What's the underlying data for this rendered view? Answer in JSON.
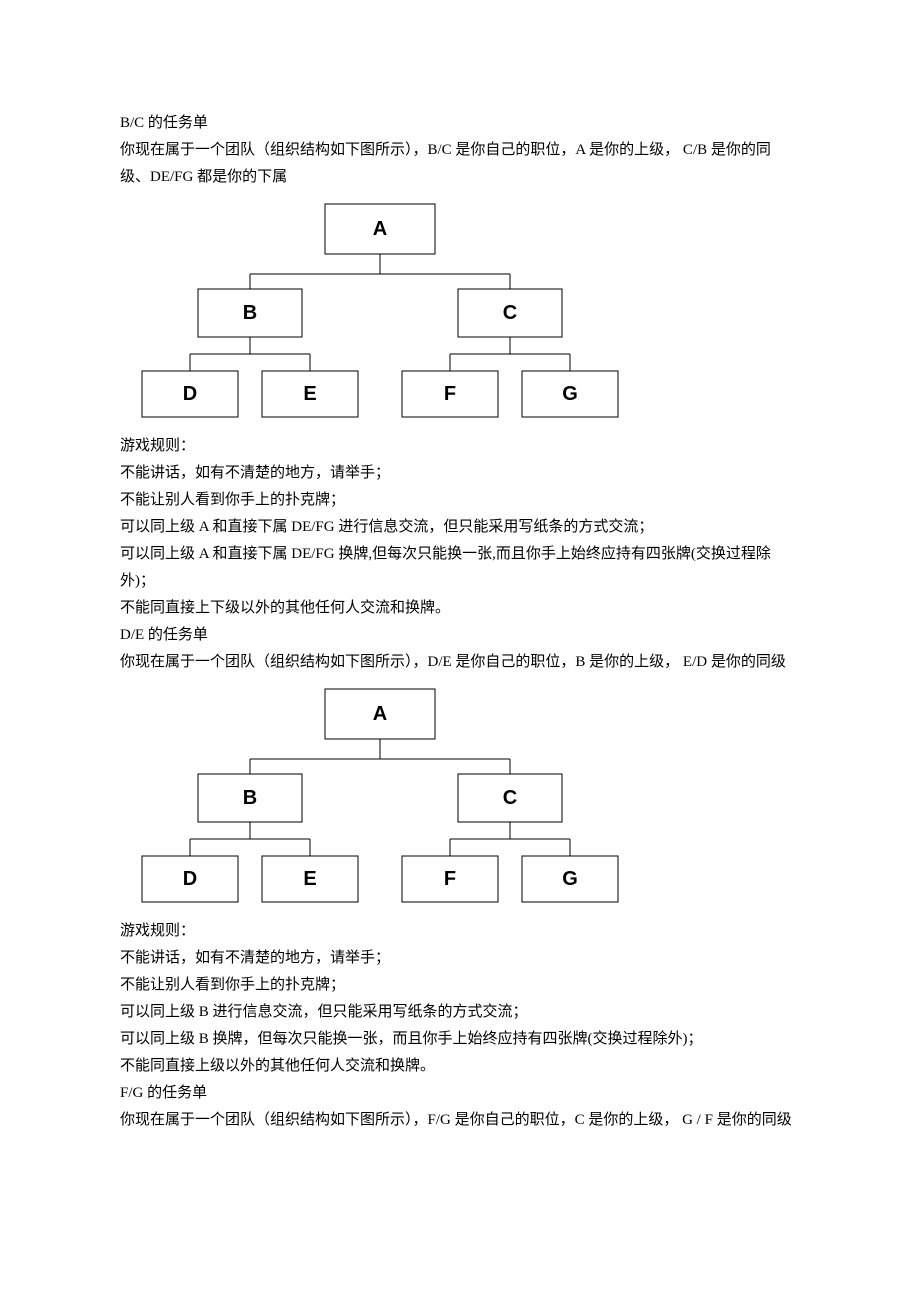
{
  "section1": {
    "title": "B/C 的任务单",
    "intro": "你现在属于一个团队（组织结构如下图所示），B/C 是你自己的职位，A 是你的上级， C/B 是你的同级、DE/FG 都是你的下属",
    "rules_heading": "游戏规则：",
    "rules": [
      "不能讲话，如有不清楚的地方，请举手；",
      "不能让别人看到你手上的扑克牌；",
      "可以同上级 A 和直接下属 DE/FG 进行信息交流，但只能采用写纸条的方式交流；",
      "可以同上级 A 和直接下属 DE/FG 换牌,但每次只能换一张,而且你手上始终应持有四张牌(交换过程除外)；",
      "不能同直接上下级以外的其他任何人交流和换牌。"
    ]
  },
  "section2": {
    "title": "D/E 的任务单",
    "intro": "你现在属于一个团队（组织结构如下图所示），D/E 是你自己的职位，B 是你的上级， E/D 是你的同级",
    "rules_heading": "游戏规则：",
    "rules": [
      "不能讲话，如有不清楚的地方，请举手；",
      "不能让别人看到你手上的扑克牌；",
      "可以同上级 B 进行信息交流，但只能采用写纸条的方式交流；",
      "可以同上级 B 换牌，但每次只能换一张，而且你手上始终应持有四张牌(交换过程除外)；",
      "不能同直接上级以外的其他任何人交流和换牌。"
    ]
  },
  "section3": {
    "title": "F/G 的任务单",
    "intro": "你现在属于一个团队（组织结构如下图所示），F/G 是你自己的职位，C 是你的上级， G / F 是你的同级"
  },
  "chart_data": {
    "type": "tree",
    "nodes": {
      "A": {
        "label": "A",
        "children": [
          "B",
          "C"
        ]
      },
      "B": {
        "label": "B",
        "children": [
          "D",
          "E"
        ]
      },
      "C": {
        "label": "C",
        "children": [
          "F",
          "G"
        ]
      },
      "D": {
        "label": "D",
        "children": []
      },
      "E": {
        "label": "E",
        "children": []
      },
      "F": {
        "label": "F",
        "children": []
      },
      "G": {
        "label": "G",
        "children": []
      }
    },
    "root": "A"
  }
}
